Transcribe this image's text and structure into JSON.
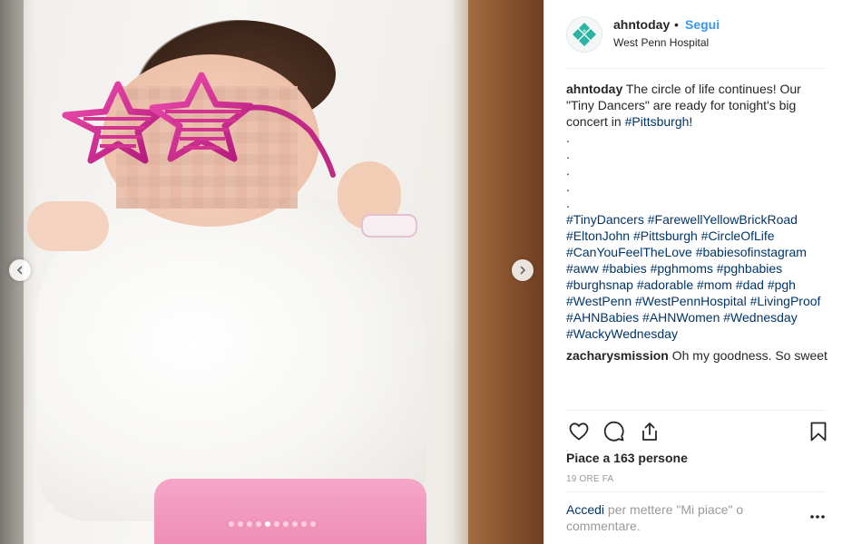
{
  "post": {
    "username": "ahntoday",
    "separator": "•",
    "follow_label": "Segui",
    "location": "West Penn Hospital",
    "caption_user": "ahntoday",
    "caption_text": "The circle of life continues! Our \"Tiny Dancers\" are ready for tonight's big concert in ",
    "caption_tag": "#Pittsburgh",
    "caption_end": "!",
    "dot_lines": [
      ".",
      ".",
      ".",
      ".",
      "."
    ],
    "hashtags": "#TinyDancers #FarewellYellowBrickRoad #EltonJohn #Pittsburgh #CircleOfLife #CanYouFeelTheLove #babiesofinstagram #aww #babies #pghmoms #pghbabies #burghsnap #adorable #mom #dad #pgh #WestPenn #WestPennHospital #LivingProof #AHNBabies #AHNWomen #Wednesday #WackyWednesday",
    "comment_user": "zacharysmission",
    "comment_text": "Oh my goodness. So sweet",
    "likes": "Piace a 163 persone",
    "time": "19 ORE FA",
    "login_link": "Accedi",
    "login_text": " per mettere \"Mi piace\" o commentare."
  },
  "carousel": {
    "total": 10,
    "active_index": 4
  },
  "icons": {
    "avatar": "ahn-logo-icon",
    "prev": "chevron-left-icon",
    "next": "chevron-right-icon",
    "like": "heart-icon",
    "comment": "comment-bubble-icon",
    "share": "share-icon",
    "save": "bookmark-icon",
    "more": "more-horizontal-icon"
  },
  "colors": {
    "link_blue": "#3897f0",
    "hashtag": "#003569",
    "text": "#262626",
    "muted": "#999999",
    "logo_teal": "#2bb3a3"
  }
}
